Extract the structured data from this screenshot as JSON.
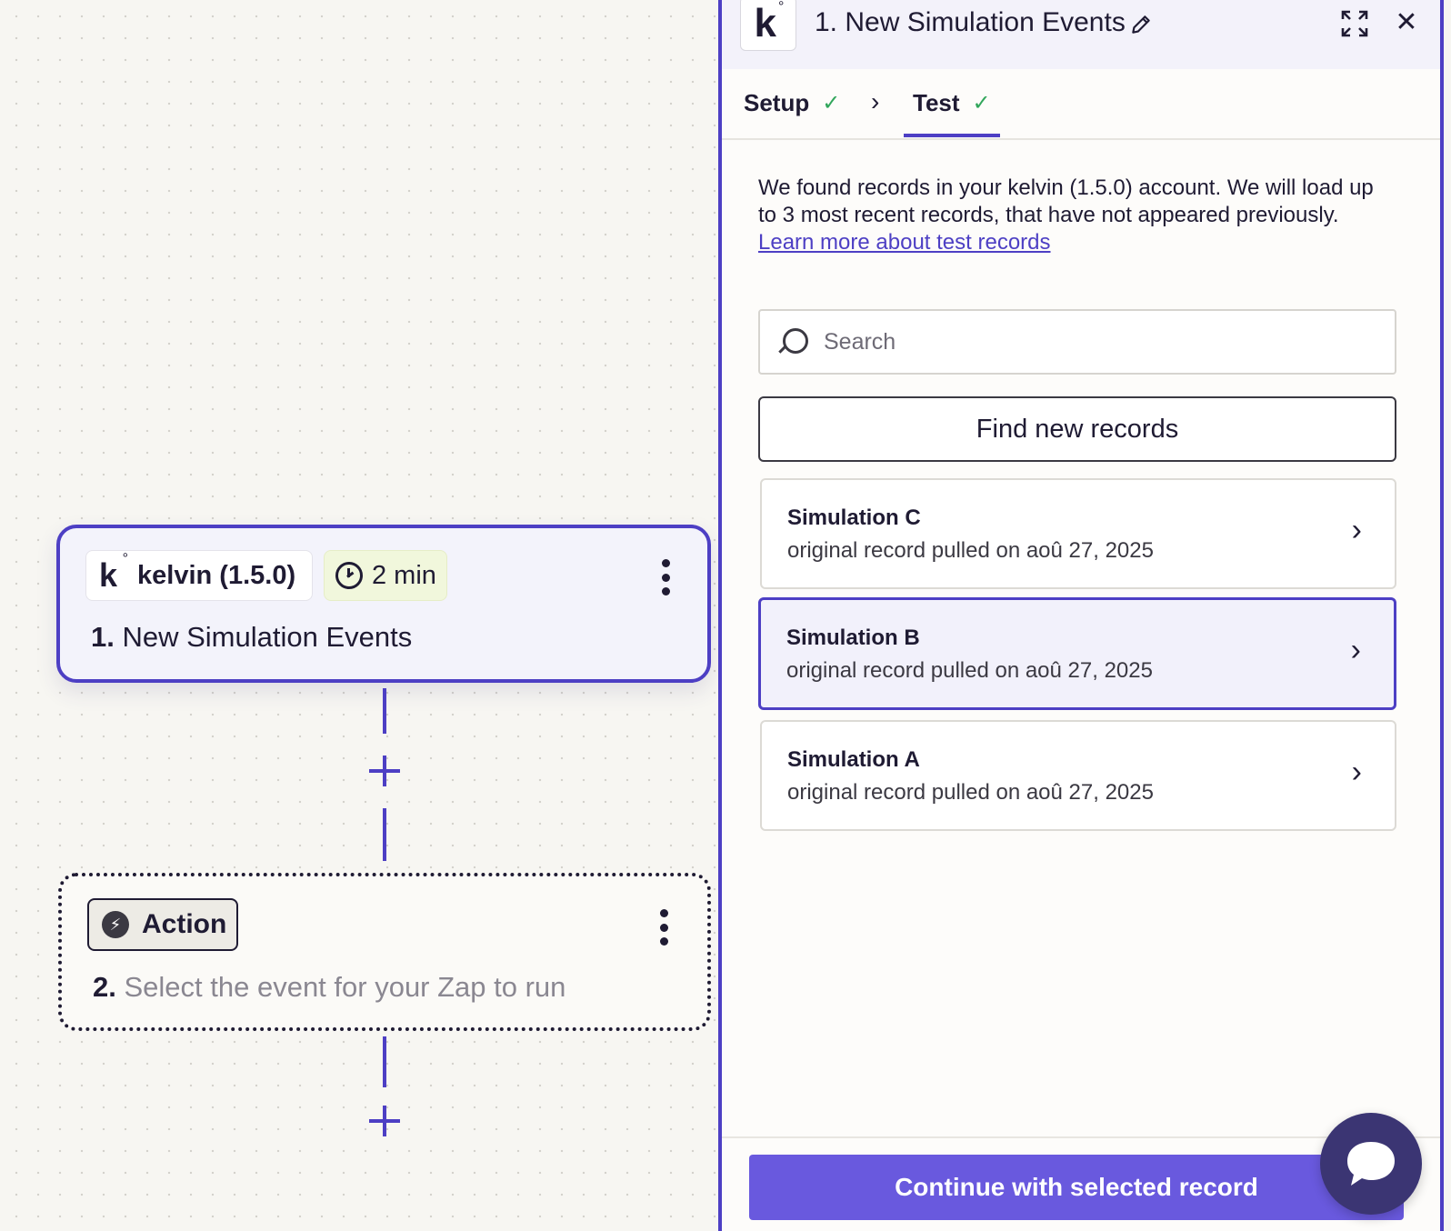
{
  "canvas": {
    "trigger": {
      "app_name": "kelvin (1.5.0)",
      "logo_letter": "k",
      "logo_mark": "°",
      "poll_interval": "2 min",
      "step_number": "1.",
      "step_title": "New Simulation Events"
    },
    "action": {
      "chip_label": "Action",
      "step_number": "2.",
      "step_title": "Select the event for your Zap to run"
    }
  },
  "panel": {
    "logo_letter": "k",
    "logo_mark": "°",
    "title": "1. New Simulation Events",
    "tabs": [
      {
        "label": "Setup",
        "status": "✓"
      },
      {
        "label": "Test",
        "status": "✓"
      }
    ],
    "tab_separator": "›",
    "intro_text": "We found records in your kelvin (1.5.0) account. We will load up to 3 most recent records, that have not appeared previously.",
    "learn_more_link": "Learn more about test records",
    "search_placeholder": "Search",
    "find_button": "Find new records",
    "records": [
      {
        "name": "Simulation C",
        "subtitle": "original record pulled on aoû 27, 2025"
      },
      {
        "name": "Simulation B",
        "subtitle": "original record pulled on aoû 27, 2025"
      },
      {
        "name": "Simulation A",
        "subtitle": "original record pulled on aoû 27, 2025"
      }
    ],
    "continue_button": "Continue with selected record",
    "close_glyph": "✕"
  },
  "colors": {
    "accent": "#4d3fc4",
    "button_primary": "#6959de",
    "success": "#31a65b",
    "chat": "#3b3573"
  }
}
